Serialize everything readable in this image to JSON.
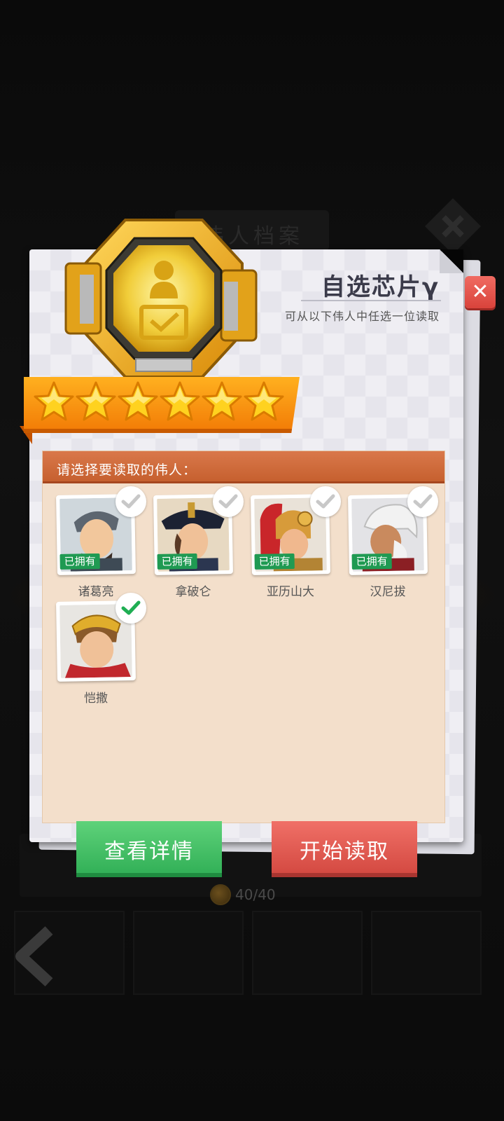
{
  "dialog": {
    "title": "自选芯片γ",
    "subtitle": "可从以下伟人中任选一位读取",
    "star_count": 6,
    "roster_header": "请选择要读取的伟人："
  },
  "heroes": [
    {
      "name": "诸葛亮",
      "owned_label": "已拥有",
      "owned": true,
      "selected": false
    },
    {
      "name": "拿破仑",
      "owned_label": "已拥有",
      "owned": true,
      "selected": false
    },
    {
      "name": "亚历山大",
      "owned_label": "已拥有",
      "owned": true,
      "selected": false
    },
    {
      "name": "汉尼拔",
      "owned_label": "已拥有",
      "owned": true,
      "selected": false
    },
    {
      "name": "恺撒",
      "owned": false,
      "selected": true
    }
  ],
  "buttons": {
    "details_label": "查看详情",
    "start_label": "开始读取"
  },
  "background": {
    "title": "伟人档案",
    "counter": "40/40"
  },
  "colors": {
    "owned_badge": "#1f9a52",
    "check_selected": "#1fae53",
    "check_unselected": "#c8c8c8",
    "details_button": "#3dbb60",
    "start_button": "#de544b"
  }
}
